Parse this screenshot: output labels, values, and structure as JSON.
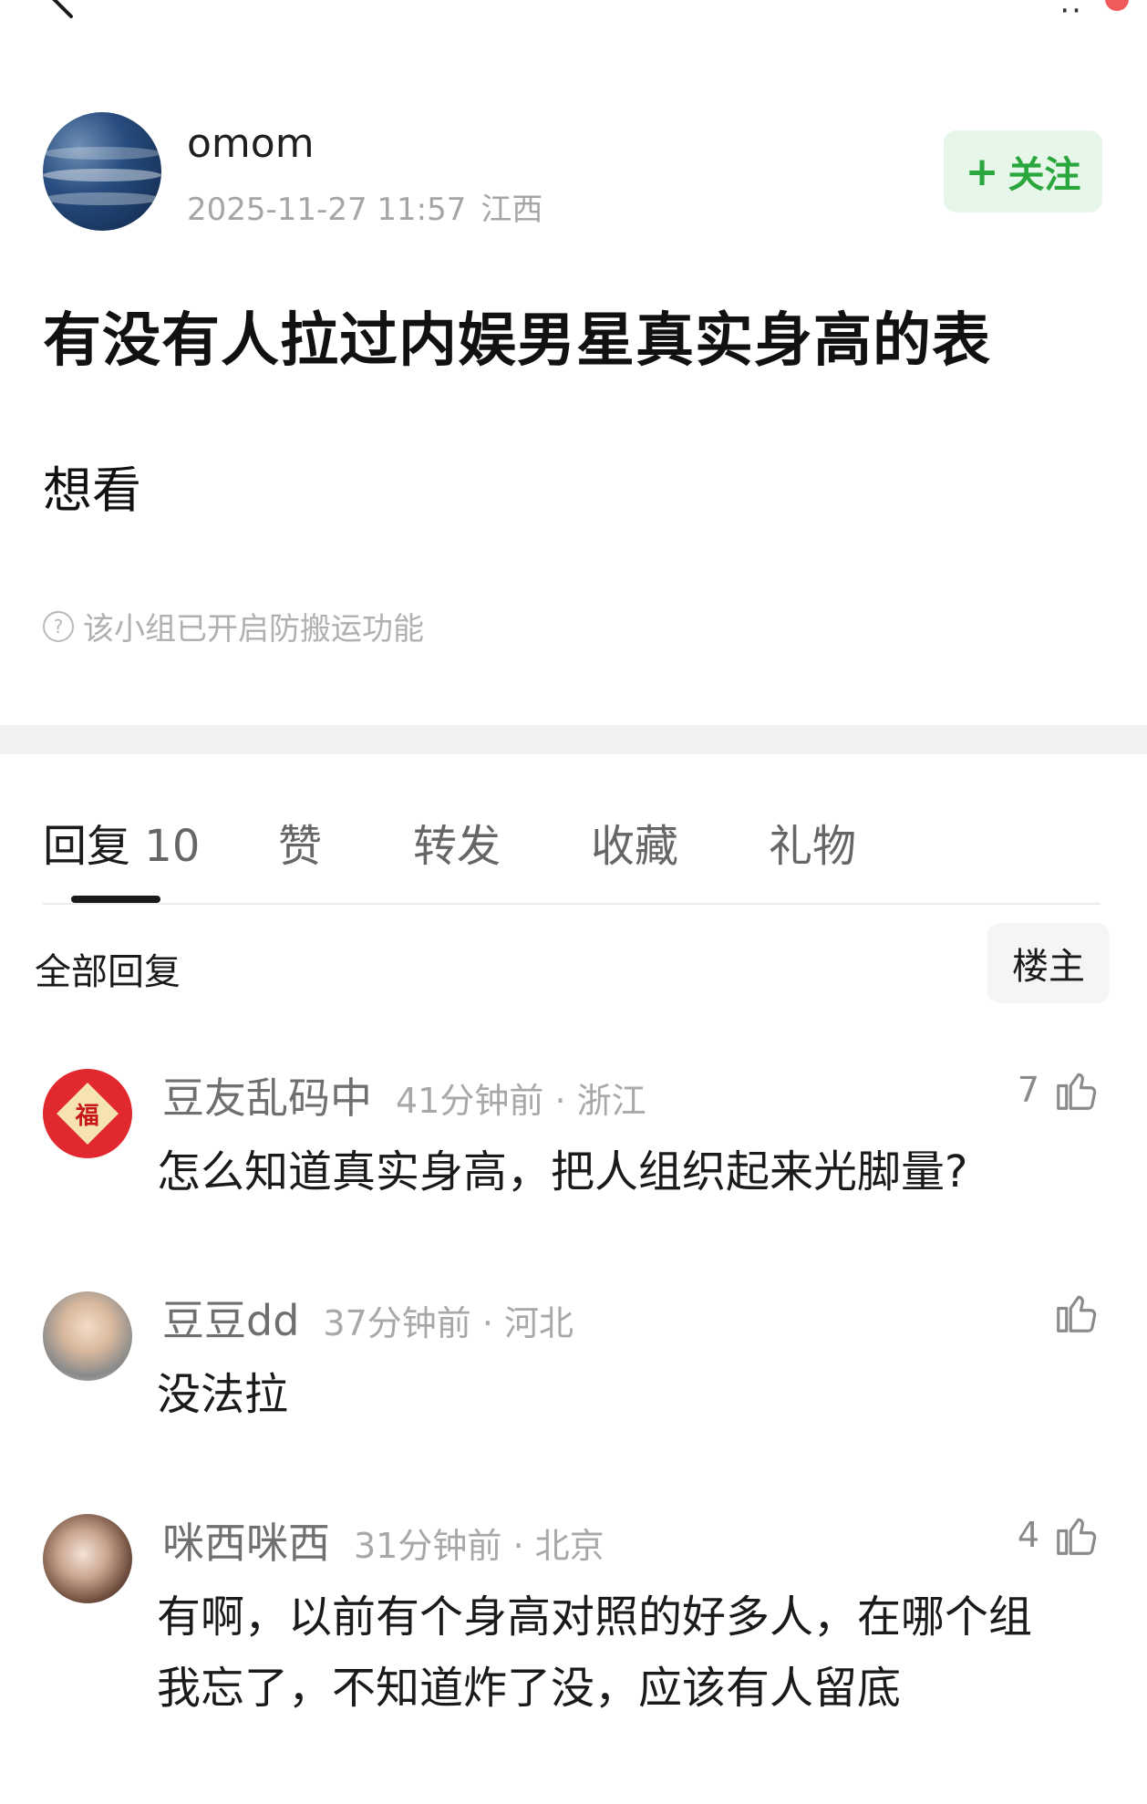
{
  "author": {
    "name": "omom",
    "datetime": "2025-11-27 11:57",
    "location": "江西",
    "follow_label": "关注",
    "follow_plus": "+"
  },
  "post": {
    "title": "有没有人拉过内娱男星真实身高的表",
    "body": "想看",
    "notice": "该小组已开启防搬运功能",
    "notice_icon": "?"
  },
  "tabs": [
    {
      "label": "回复",
      "count": "10"
    },
    {
      "label": "赞"
    },
    {
      "label": "转发"
    },
    {
      "label": "收藏"
    },
    {
      "label": "礼物"
    }
  ],
  "filter": {
    "label": "全部回复",
    "op_button": "楼主"
  },
  "comments": [
    {
      "name": "豆友乱码中",
      "time": "41分钟前",
      "location": "浙江",
      "likes": "7",
      "text": "怎么知道真实身高，把人组织起来光脚量?"
    },
    {
      "name": "豆豆dd",
      "time": "37分钟前",
      "location": "河北",
      "likes": "",
      "text": "没法拉"
    },
    {
      "name": "咪西咪西",
      "time": "31分钟前",
      "location": "北京",
      "likes": "4",
      "text": "有啊，以前有个身高对照的好多人，在哪个组我忘了，不知道炸了没，应该有人留底"
    }
  ],
  "avatar_glyph": "福",
  "meta_separator": "·",
  "colors": {
    "follow_green": "#2aa73c",
    "follow_bg": "#e6f6e8",
    "badge_red": "#f05a5a"
  }
}
